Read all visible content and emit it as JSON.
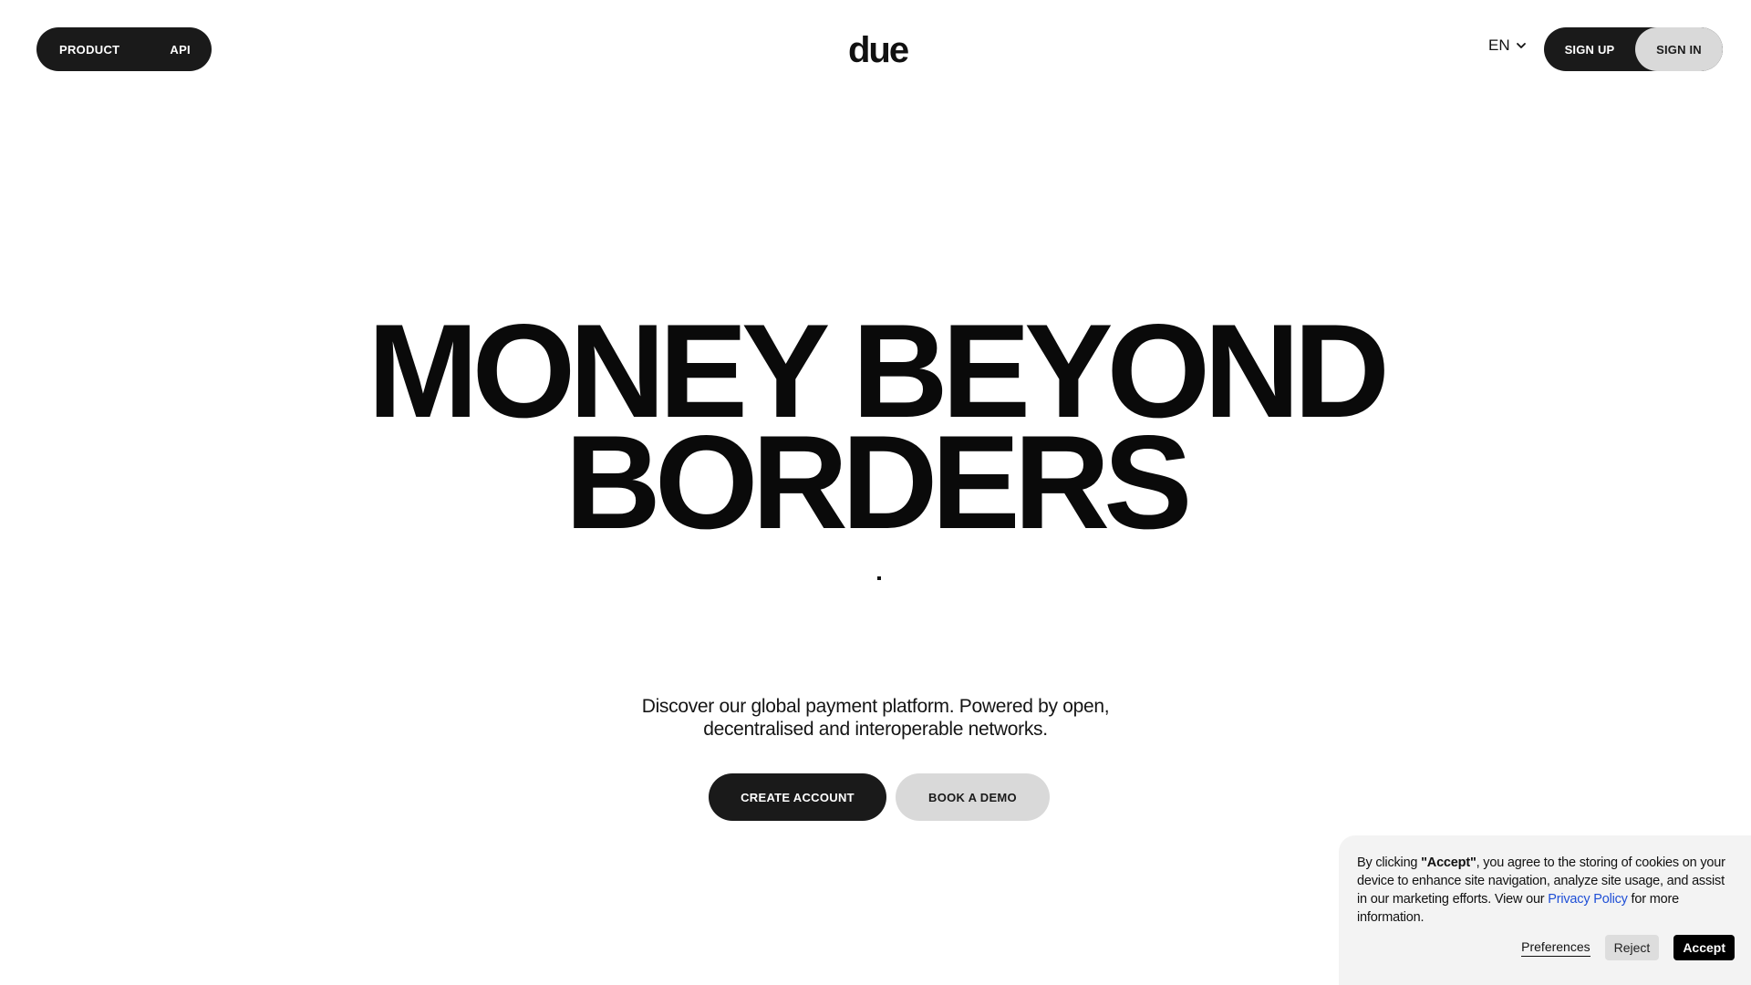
{
  "header": {
    "nav": {
      "product_label": "PRODUCT",
      "api_label": "API"
    },
    "logo_text": "due",
    "language": {
      "selected": "EN",
      "icon": "chevron-down-icon"
    },
    "signup_label": "SIGN UP",
    "signin_label": "SIGN IN"
  },
  "hero": {
    "title_line1": "MONEY BEYOND",
    "title_line2": "BORDERS",
    "subtitle_line1": "Discover our global payment platform. Powered by open,",
    "subtitle_line2": "decentralised and interoperable networks.",
    "create_account_label": "CREATE ACCOUNT",
    "book_demo_label": "BOOK A DEMO"
  },
  "cookie_banner": {
    "text_prefix": "By clicking ",
    "text_bold": "\"Accept\"",
    "text_middle": ", you agree to the storing of cookies on your device to enhance site navigation, analyze site usage, and assist in our marketing efforts. View our ",
    "privacy_link": "Privacy Policy",
    "text_suffix": " for more information.",
    "preferences_label": "Preferences",
    "reject_label": "Reject",
    "accept_label": "Accept"
  },
  "colors": {
    "dark": "#1a1a1a",
    "light_button": "#d9d9d9",
    "link": "#1f4fd6",
    "cookie_bg": "#f3f3f3"
  }
}
